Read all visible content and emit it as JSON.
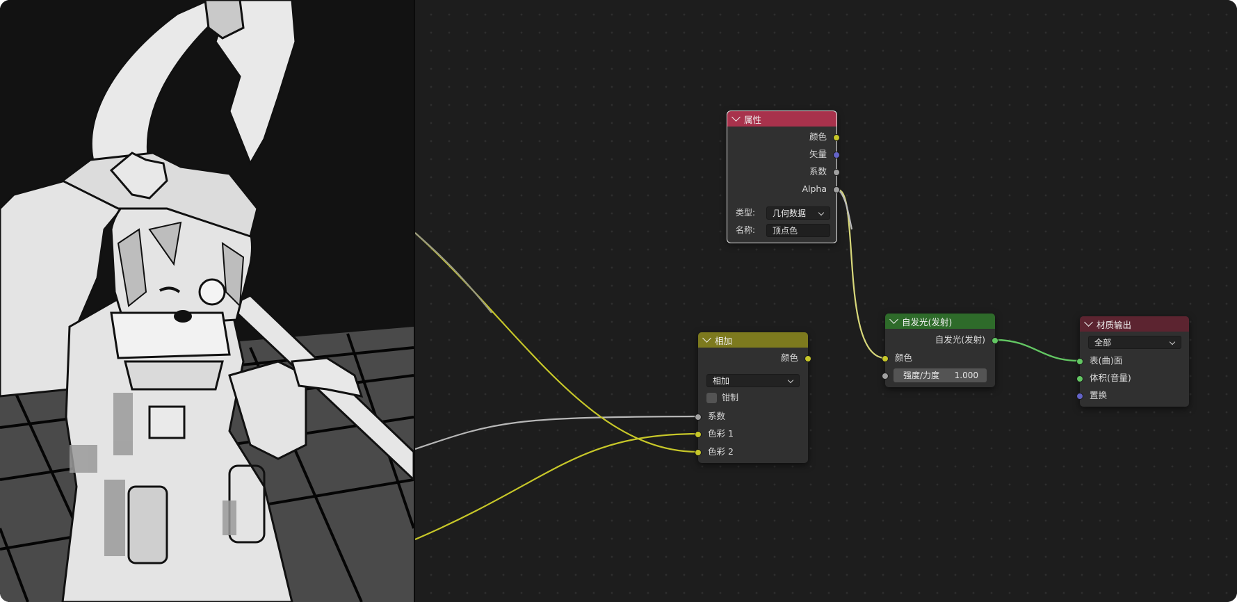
{
  "colors": {
    "attribute_header": "#a8324c",
    "mix_header": "#7d7a1e",
    "emission_header": "#2e6b2a",
    "output_header": "#5c2430",
    "socket_yellow": "#c7c729",
    "socket_blue": "#6363c7",
    "socket_gray": "#a1a1a1",
    "socket_green": "#63c763"
  },
  "nodes": {
    "attribute": {
      "title": "属性",
      "outputs": {
        "color": "颜色",
        "vector": "矢量",
        "factor": "系数",
        "alpha": "Alpha"
      },
      "type_label": "类型:",
      "type_value": "几何数据",
      "name_label": "名称:",
      "name_value": "顶点色"
    },
    "mix": {
      "title": "相加",
      "output_color": "颜色",
      "blend_mode": "相加",
      "clamp_label": "钳制",
      "inputs": {
        "factor": "系数",
        "color1": "色彩 1",
        "color2": "色彩 2"
      }
    },
    "emission": {
      "title": "自发光(发射)",
      "output": "自发光(发射)",
      "input_color": "颜色",
      "strength_label": "强度/力度",
      "strength_value": "1.000"
    },
    "material_output": {
      "title": "材质输出",
      "target": "全部",
      "inputs": {
        "surface": "表(曲)面",
        "volume": "体积(音量)",
        "displacement": "置换"
      }
    }
  }
}
